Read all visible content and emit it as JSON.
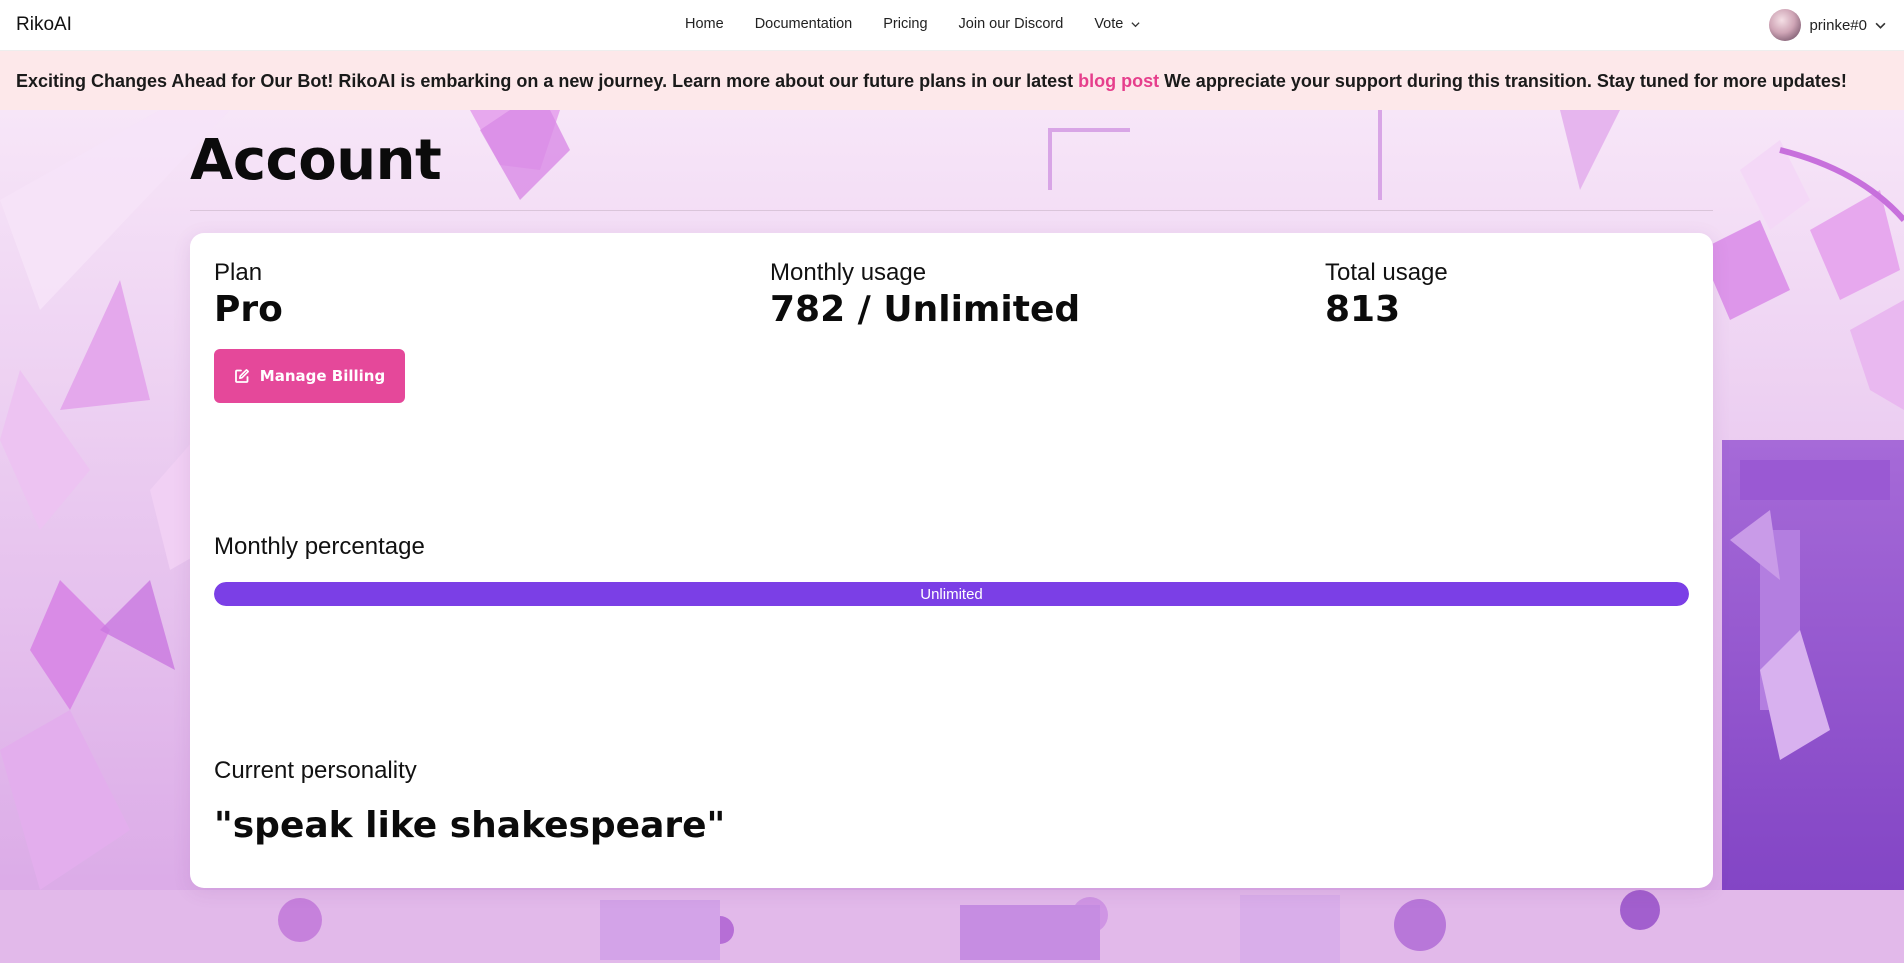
{
  "nav": {
    "brand": "RikoAI",
    "links": [
      "Home",
      "Documentation",
      "Pricing",
      "Join our Discord"
    ],
    "vote_label": "Vote",
    "username": "prinke#0"
  },
  "announcement": {
    "text_before": "Exciting Changes Ahead for Our Bot! RikoAI is embarking on a new journey. Learn more about our future plans in our latest ",
    "link_text": "blog post",
    "text_after": " We appreciate your support during this transition. Stay tuned for more updates!"
  },
  "page": {
    "title": "Account"
  },
  "stats": {
    "plan_label": "Plan",
    "plan_value": "Pro",
    "monthly_label": "Monthly usage",
    "monthly_value": "782 / Unlimited",
    "total_label": "Total usage",
    "total_value": "813"
  },
  "billing": {
    "button_label": "Manage Billing",
    "icon": "edit-icon"
  },
  "monthly_percentage": {
    "label": "Monthly percentage",
    "bar_text": "Unlimited",
    "fill_fraction": 1.0
  },
  "personality": {
    "label": "Current personality",
    "value": "\"speak like shakespeare\""
  },
  "colors": {
    "accent_pink": "#e5489a",
    "link_pink": "#e63e8c",
    "progress_purple": "#7b3fe6",
    "announcement_bg": "#fde8ea"
  }
}
